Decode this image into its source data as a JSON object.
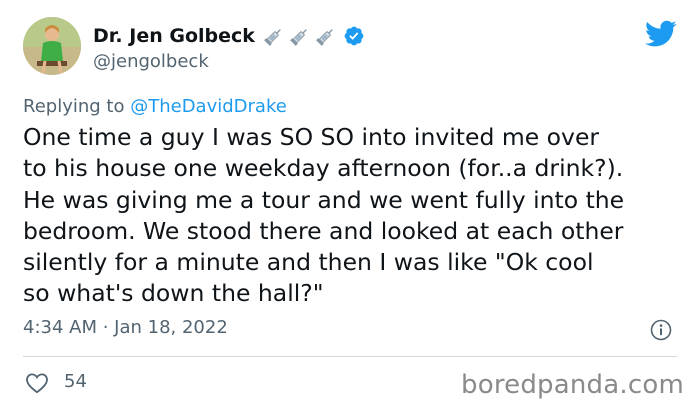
{
  "author": {
    "display_name": "Dr. Jen Golbeck",
    "handle": "@jengolbeck",
    "name_emojis": [
      "syringe-icon",
      "syringe-icon",
      "syringe-icon"
    ],
    "verified": true
  },
  "reply": {
    "prefix": "Replying to",
    "to_handle": "@TheDavidDrake"
  },
  "tweet": {
    "text": "One time a guy I was SO SO into invited me over\nto his house one weekday afternoon (for..a drink?).\nHe was giving me a tour and we went fully into the\nbedroom. We stood there and looked at each other\nsilently for a minute and then I was like \"Ok cool\nso what's down the hall?\"",
    "timestamp": "4:34 AM · Jan 18, 2022"
  },
  "engagement": {
    "likes": "54"
  },
  "colors": {
    "accent": "#1d9bf0",
    "secondary_text": "#536471",
    "primary_text": "#0f1419",
    "divider": "#cfd9de"
  },
  "watermark": "boredpanda.com"
}
